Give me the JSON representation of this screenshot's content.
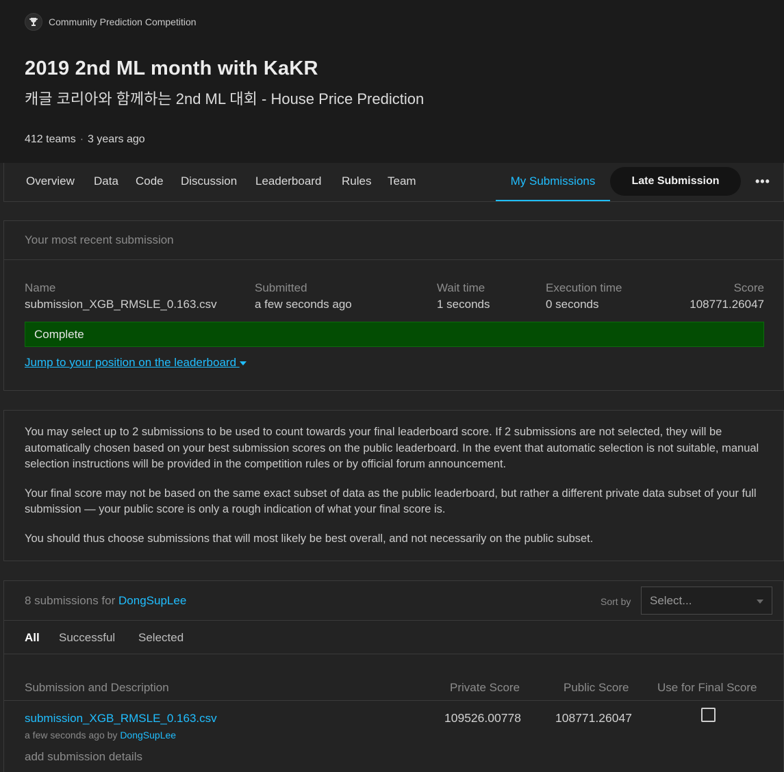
{
  "header": {
    "competition_kind": "Community Prediction Competition",
    "title": "2019 2nd ML month with KaKR",
    "subtitle": "캐글 코리아와 함께하는 2nd ML 대회 - House Price Prediction",
    "teams": "412 teams",
    "separator": "·",
    "age": "3 years ago"
  },
  "nav": {
    "tabs": [
      "Overview",
      "Data",
      "Code",
      "Discussion",
      "Leaderboard",
      "Rules",
      "Team"
    ],
    "my_submissions": "My Submissions",
    "late_submission": "Late Submission",
    "more": "•••"
  },
  "recent": {
    "heading": "Your most recent submission",
    "name_label": "Name",
    "name_value": "submission_XGB_RMSLE_0.163.csv",
    "submitted_label": "Submitted",
    "submitted_value": "a few seconds ago",
    "wait_label": "Wait time",
    "wait_value": "1 seconds",
    "exec_label": "Execution time",
    "exec_value": "0 seconds",
    "score_label": "Score",
    "score_value": "108771.26047",
    "status": "Complete",
    "jump_link": "Jump to your position on the leaderboard"
  },
  "info": {
    "p1": "You may select up to 2 submissions to be used to count towards your final leaderboard score. If 2 submissions are not selected, they will be automatically chosen based on your best submission scores on the public leaderboard. In the event that automatic selection is not suitable, manual selection instructions will be provided in the competition rules or by official forum announcement.",
    "p2": "Your final score may not be based on the same exact subset of data as the public leaderboard, but rather a different private data subset of your full submission — your public score is only a rough indication of what your final score is.",
    "p3": "You should thus choose submissions that will most likely be best overall, and not necessarily on the public subset."
  },
  "submissions": {
    "count_text": "8 submissions for",
    "user": "DongSupLee",
    "sort_label": "Sort by",
    "sort_placeholder": "Select...",
    "tabs": [
      "All",
      "Successful",
      "Selected"
    ],
    "columns": [
      "Submission and Description",
      "Private Score",
      "Public Score",
      "Use for Final Score"
    ],
    "rows": [
      {
        "file": "submission_XGB_RMSLE_0.163.csv",
        "when": "a few seconds ago by",
        "by": "DongSupLee",
        "add_details": "add submission details",
        "private_score": "109526.00778",
        "public_score": "108771.26047"
      }
    ]
  },
  "colors": {
    "accent": "#20beff",
    "complete_bg": "#034d03",
    "background": "#242424",
    "header_bg": "#1b1b1b"
  }
}
